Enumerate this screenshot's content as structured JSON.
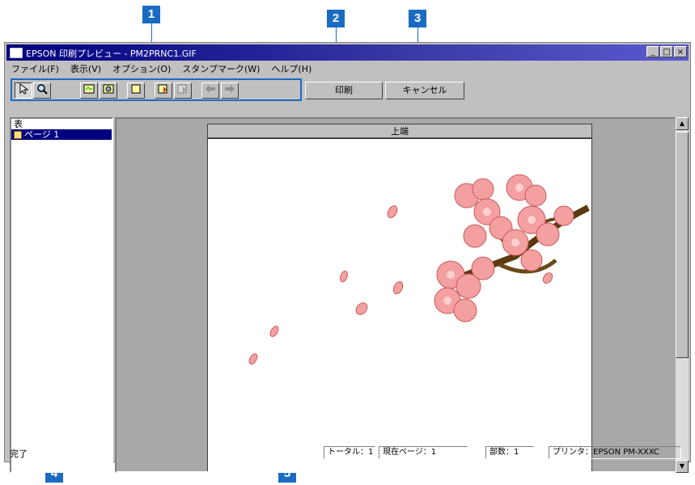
{
  "window": {
    "title": "EPSON 印刷プレビュー - PM2PRNC1.GIF"
  },
  "window_buttons": {
    "minimize": "_",
    "maximize": "□",
    "close": "×"
  },
  "menu": [
    "ファイル(F)",
    "表示(V)",
    "オプション(O)",
    "スタンプマーク(W)",
    "ヘルプ(H)"
  ],
  "toolbar": {
    "print_label": "印刷",
    "cancel_label": "キャンセル"
  },
  "left_pane": {
    "header": "表",
    "page_item": "ページ 1"
  },
  "preview": {
    "top_edge_label": "上端"
  },
  "status": {
    "left": "完了",
    "total": "トータル：1",
    "current_page": "現在ページ：1",
    "copies": "部数：1",
    "printer": "プリンタ：EPSON PM-XXXC"
  },
  "callouts": [
    "1",
    "2",
    "3",
    "4",
    "5"
  ],
  "colors": {
    "callout": "#1a6bc4",
    "titlebar": "#000080",
    "petal": "#f4a0a0",
    "branch": "#5a3a10"
  }
}
